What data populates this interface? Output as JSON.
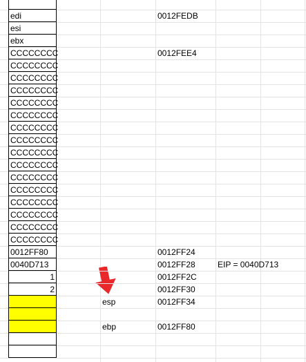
{
  "stack_cells": [
    {
      "text": "",
      "highlight": false,
      "align": "left"
    },
    {
      "text": "edi",
      "highlight": false,
      "align": "left"
    },
    {
      "text": "esi",
      "highlight": false,
      "align": "left"
    },
    {
      "text": "ebx",
      "highlight": false,
      "align": "left"
    },
    {
      "text": "CCCCCCCC",
      "highlight": false,
      "align": "left"
    },
    {
      "text": "CCCCCCCC",
      "highlight": false,
      "align": "left"
    },
    {
      "text": "CCCCCCCC",
      "highlight": false,
      "align": "left"
    },
    {
      "text": "CCCCCCCC",
      "highlight": false,
      "align": "left"
    },
    {
      "text": "CCCCCCCC",
      "highlight": false,
      "align": "left"
    },
    {
      "text": "CCCCCCCC",
      "highlight": false,
      "align": "left"
    },
    {
      "text": "CCCCCCCC",
      "highlight": false,
      "align": "left"
    },
    {
      "text": "CCCCCCCC",
      "highlight": false,
      "align": "left"
    },
    {
      "text": "CCCCCCCC",
      "highlight": false,
      "align": "left"
    },
    {
      "text": "CCCCCCCC",
      "highlight": false,
      "align": "left"
    },
    {
      "text": "CCCCCCCC",
      "highlight": false,
      "align": "left"
    },
    {
      "text": "CCCCCCCC",
      "highlight": false,
      "align": "left"
    },
    {
      "text": "CCCCCCCC",
      "highlight": false,
      "align": "left"
    },
    {
      "text": "CCCCCCCC",
      "highlight": false,
      "align": "left"
    },
    {
      "text": "CCCCCCCC",
      "highlight": false,
      "align": "left"
    },
    {
      "text": "CCCCCCCC",
      "highlight": false,
      "align": "left"
    },
    {
      "text": "0012FF80",
      "highlight": false,
      "align": "left"
    },
    {
      "text": "0040D713",
      "highlight": false,
      "align": "left"
    },
    {
      "text": "1",
      "highlight": false,
      "align": "right"
    },
    {
      "text": "2",
      "highlight": false,
      "align": "right"
    },
    {
      "text": "",
      "highlight": true,
      "align": "left"
    },
    {
      "text": "",
      "highlight": true,
      "align": "left"
    },
    {
      "text": "",
      "highlight": true,
      "align": "left"
    },
    {
      "text": "",
      "highlight": false,
      "align": "left"
    },
    {
      "text": "",
      "highlight": false,
      "align": "left"
    }
  ],
  "address_col": [
    {
      "row": 1,
      "text": "0012FEDB"
    },
    {
      "row": 4,
      "text": "0012FEE4"
    },
    {
      "row": 20,
      "text": "0012FF24"
    },
    {
      "row": 21,
      "text": "0012FF28"
    },
    {
      "row": 22,
      "text": "0012FF2C"
    },
    {
      "row": 23,
      "text": "0012FF30"
    },
    {
      "row": 24,
      "text": "0012FF34"
    },
    {
      "row": 26,
      "text": "0012FF80"
    }
  ],
  "register_labels": [
    {
      "row": 24,
      "text": "esp"
    },
    {
      "row": 26,
      "text": "ebp"
    }
  ],
  "notes": [
    {
      "row": 21,
      "text": "EIP = 0040D713"
    }
  ],
  "colors": {
    "highlight": "#ffff00",
    "arrow": "#e8282a",
    "gridline": "#e3e3e3"
  },
  "icons": {
    "pointer": "red-down-arrow-icon"
  }
}
